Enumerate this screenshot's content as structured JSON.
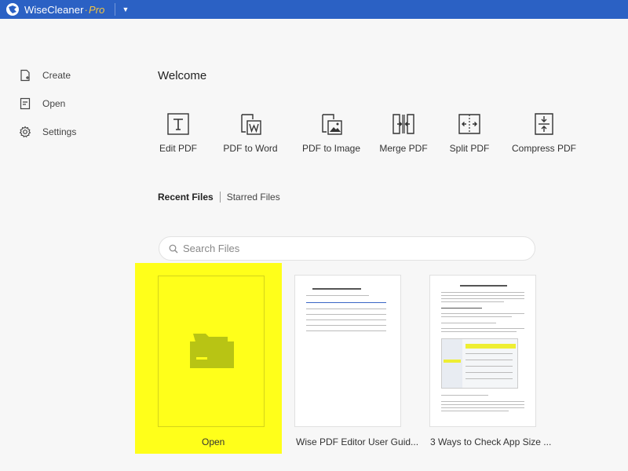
{
  "titlebar": {
    "app_name": "WiseCleaner",
    "edition": "Pro",
    "menu_glyph": "▼",
    "logo_icon": "wisecleaner-logo-icon",
    "color": "#2b61c4"
  },
  "sidebar": {
    "items": [
      {
        "label": "Create",
        "icon": "create-file-icon"
      },
      {
        "label": "Open",
        "icon": "open-file-icon"
      },
      {
        "label": "Settings",
        "icon": "gear-icon"
      }
    ]
  },
  "main": {
    "welcome": "Welcome",
    "tools": [
      {
        "label": "Edit PDF",
        "icon": "text-edit-icon"
      },
      {
        "label": "PDF to Word",
        "icon": "word-convert-icon"
      },
      {
        "label": "PDF to Image",
        "icon": "image-convert-icon"
      },
      {
        "label": "Merge PDF",
        "icon": "merge-icon"
      },
      {
        "label": "Split PDF",
        "icon": "split-icon"
      },
      {
        "label": "Compress PDF",
        "icon": "compress-icon"
      }
    ],
    "tabs": [
      {
        "label": "Recent Files",
        "active": true
      },
      {
        "label": "Starred Files",
        "active": false
      }
    ],
    "search": {
      "placeholder": "Search Files",
      "value": ""
    },
    "files": [
      {
        "label": "Open",
        "icon": "folder-icon",
        "highlight": "#ffff1a"
      },
      {
        "label": "Wise PDF Editor User Guid..."
      },
      {
        "label": "3 Ways to Check App Size ..."
      }
    ]
  }
}
